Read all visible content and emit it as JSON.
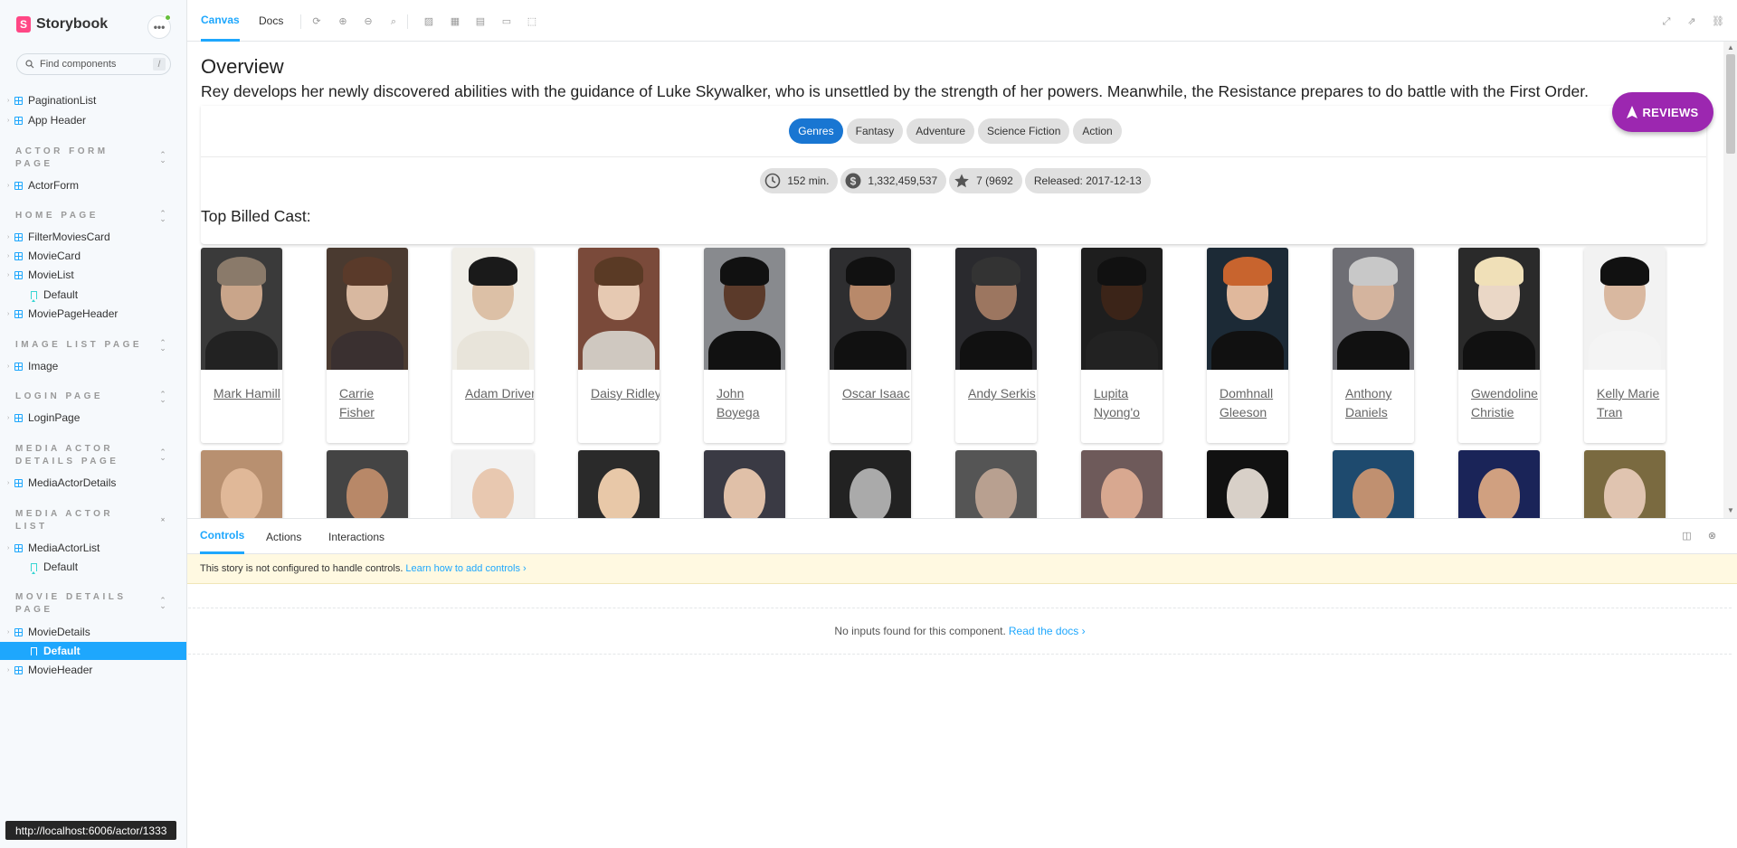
{
  "sidebar": {
    "brand": "Storybook",
    "menu_label": "•••",
    "search_placeholder": "Find components",
    "search_shortcut": "/",
    "items": [
      {
        "label": "PaginationList"
      },
      {
        "label": "App Header"
      },
      {
        "group": "ACTOR FORM PAGE"
      },
      {
        "label": "ActorForm"
      },
      {
        "group": "HOME PAGE"
      },
      {
        "label": "FilterMoviesCard"
      },
      {
        "label": "MovieCard"
      },
      {
        "label": "MovieList"
      },
      {
        "label": "Default"
      },
      {
        "label": "MoviePageHeader"
      },
      {
        "group": "IMAGE LIST PAGE"
      },
      {
        "label": "Image"
      },
      {
        "group": "LOGIN PAGE"
      },
      {
        "label": "LoginPage"
      },
      {
        "group": "MEDIA ACTOR DETAILS PAGE"
      },
      {
        "label": "MediaActorDetails"
      },
      {
        "group": "MEDIA ACTOR LIST"
      },
      {
        "label": "MediaActorList"
      },
      {
        "label": "Default"
      },
      {
        "group": "MOVIE DETAILS PAGE"
      },
      {
        "label": "MovieDetails"
      },
      {
        "label": "Default"
      },
      {
        "label": "MovieHeader"
      }
    ]
  },
  "status_url": "http://localhost:6006/actor/1333",
  "toolbar": {
    "tabs": [
      "Canvas",
      "Docs"
    ]
  },
  "preview": {
    "overview_title": "Overview",
    "overview_text": "Rey develops her newly discovered abilities with the guidance of Luke Skywalker, who is unsettled by the strength of her powers. Meanwhile, the Resistance prepares to do battle with the First Order.",
    "genres_label": "Genres",
    "genres": [
      "Fantasy",
      "Adventure",
      "Science Fiction",
      "Action"
    ],
    "runtime": "152 min.",
    "revenue": "1,332,459,537",
    "rating": "7 (9692",
    "released": "Released: 2017-12-13",
    "reviews_label": "REVIEWS",
    "cast_title": "Top Billed Cast:",
    "cast": [
      {
        "name": "Mark Hamill"
      },
      {
        "name": "Carrie Fisher"
      },
      {
        "name": "Adam Driver"
      },
      {
        "name": "Daisy Ridley"
      },
      {
        "name": "John Boyega"
      },
      {
        "name": "Oscar Isaac"
      },
      {
        "name": "Andy Serkis"
      },
      {
        "name": "Lupita Nyong'o"
      },
      {
        "name": "Domhnall Gleeson"
      },
      {
        "name": "Anthony Daniels"
      },
      {
        "name": "Gwendoline Christie"
      },
      {
        "name": "Kelly Marie Tran"
      }
    ]
  },
  "addons": {
    "tabs": [
      "Controls",
      "Actions",
      "Interactions"
    ],
    "warning_text": "This story is not configured to handle controls.",
    "warning_link": "Learn how to add controls ›",
    "empty_text": "No inputs found for this component.",
    "empty_link": "Read the docs ›"
  },
  "colors": {
    "accent": "#1ea7fd",
    "brand": "#ff4785",
    "genre_primary": "#1976d2",
    "reviews_fab": "#9c27b0",
    "warning_bg": "#fff9e1"
  }
}
